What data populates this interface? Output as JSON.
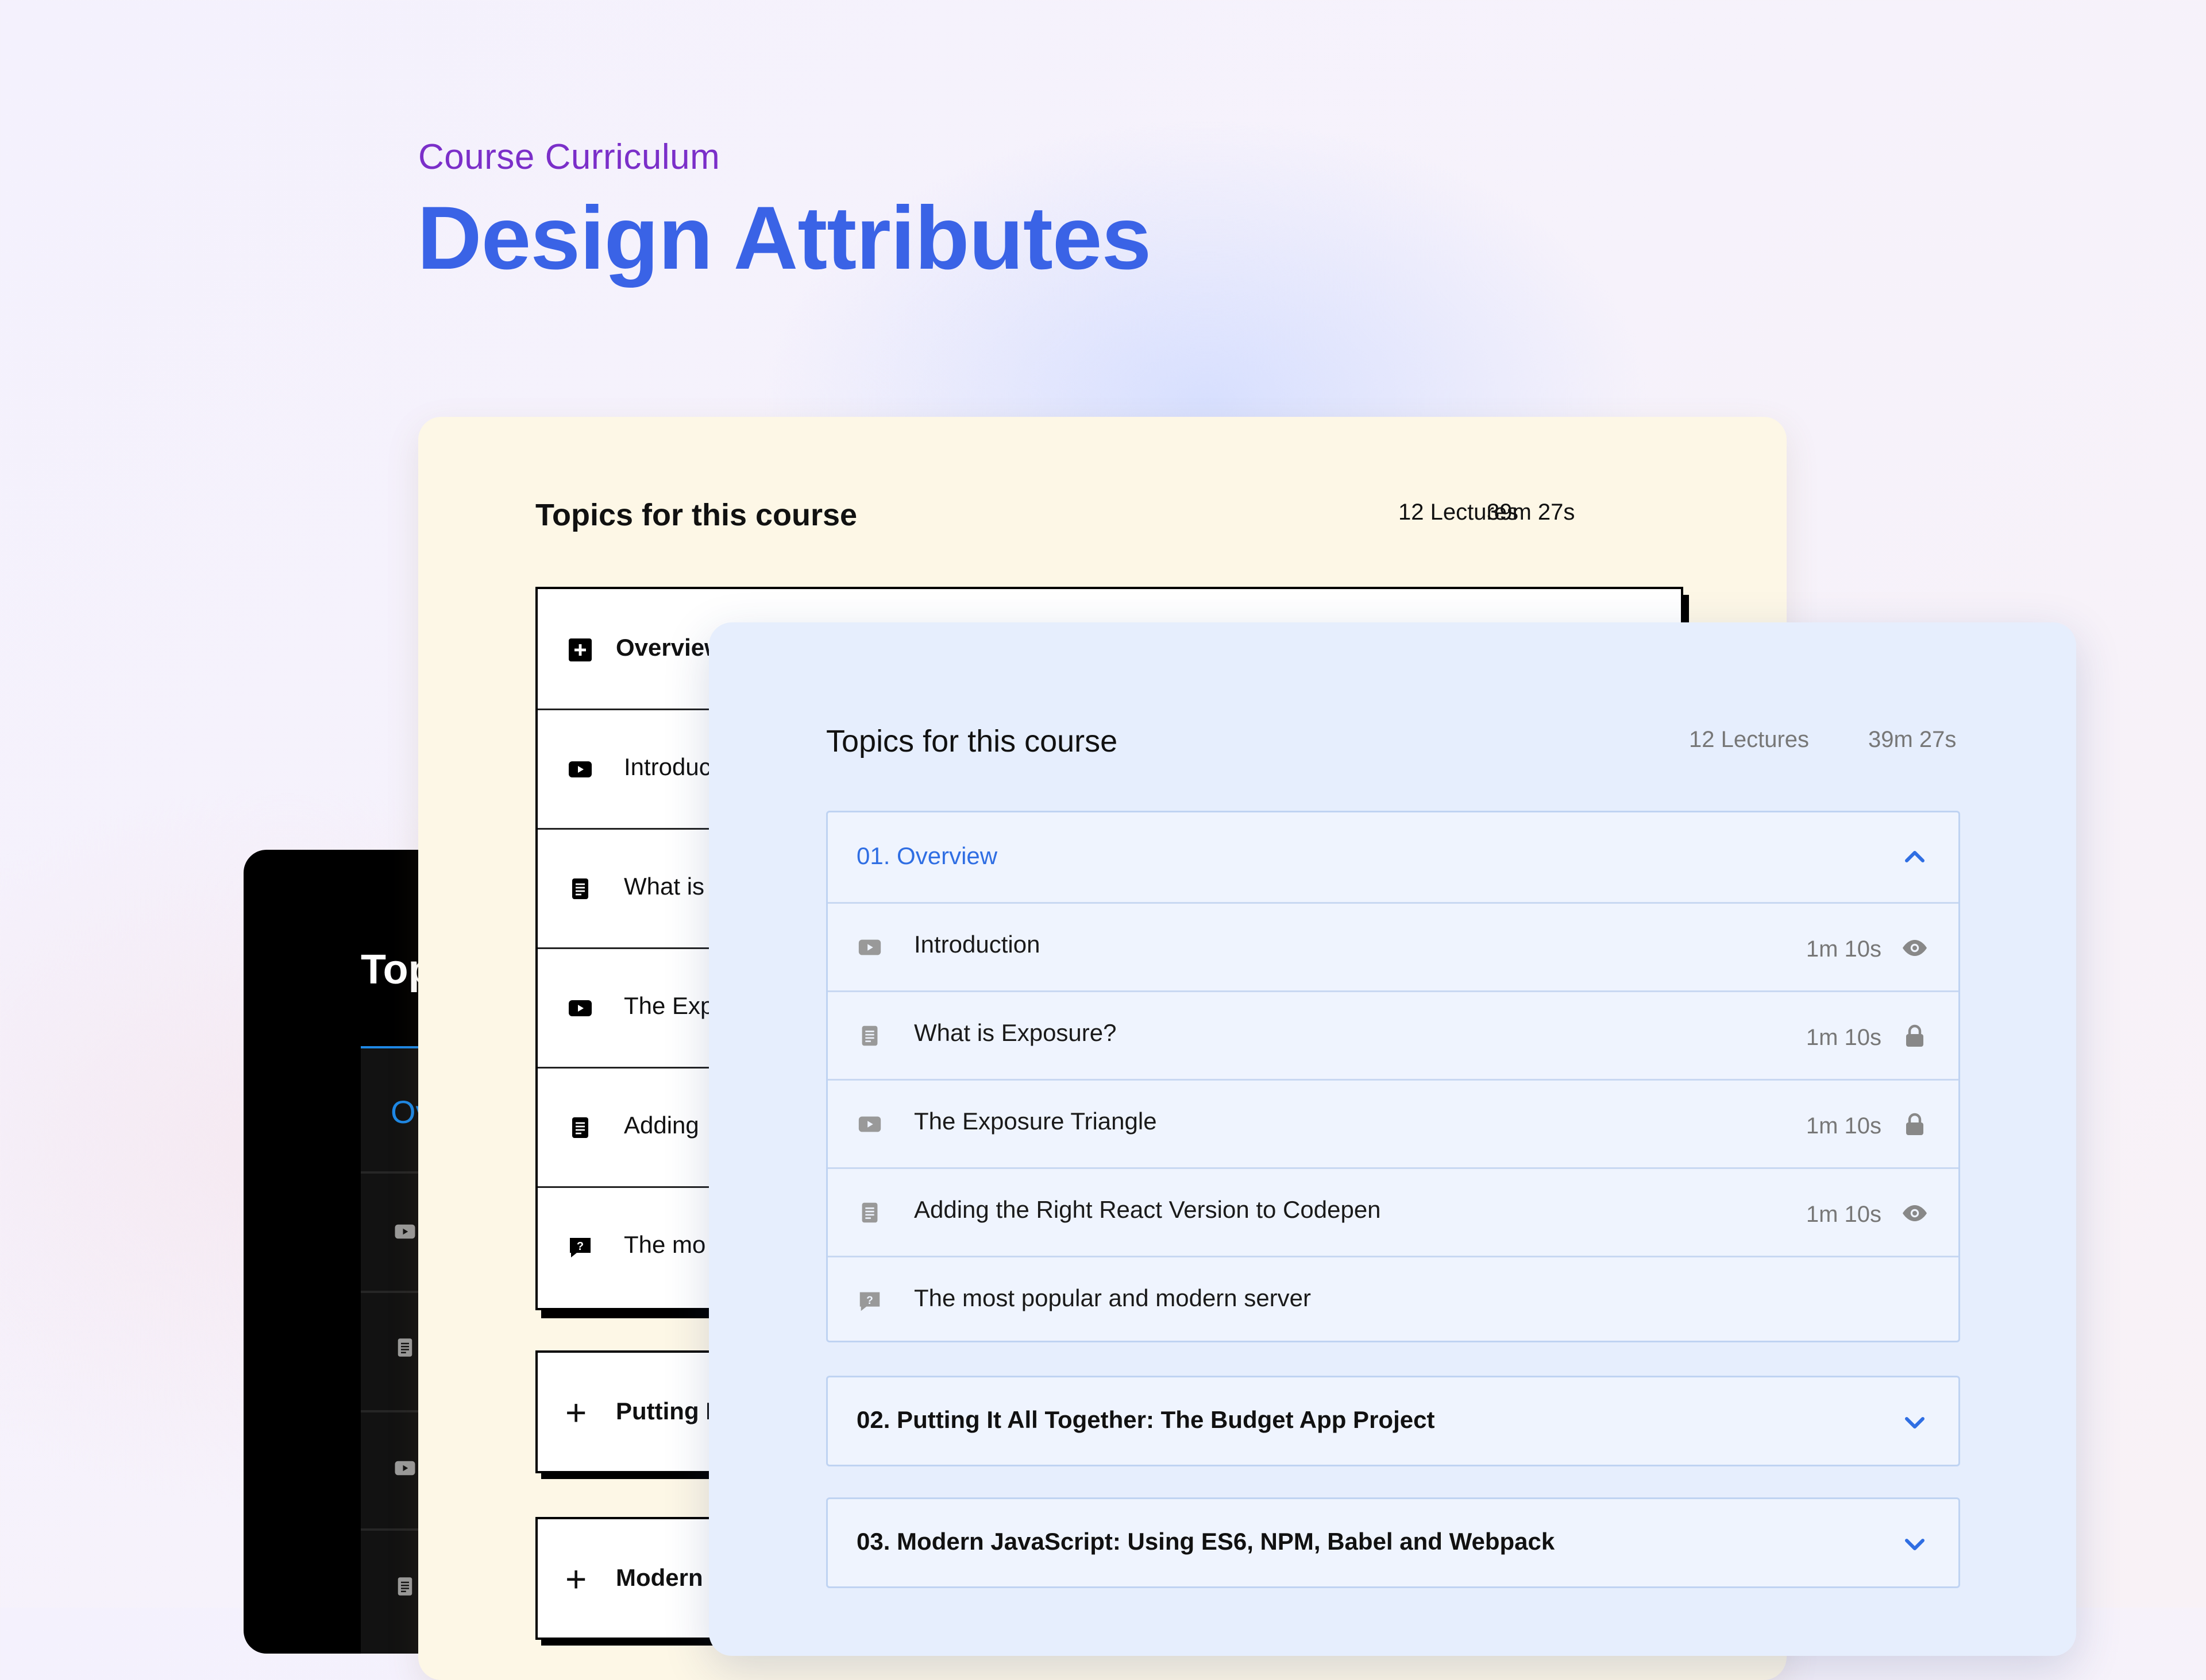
{
  "hero": {
    "eyebrow": "Course Curriculum",
    "title": "Design Attributes"
  },
  "dark_card": {
    "title_fragment": "Top",
    "section_fragment": "Ov",
    "accent_color": "#1e88e5",
    "row_icons": [
      "play-icon",
      "document-icon",
      "play-icon",
      "document-icon"
    ]
  },
  "cream_card": {
    "heading": "Topics for this course",
    "lectures": "12 Lectures",
    "duration": "39m 27s",
    "open_section": {
      "title": "Overview",
      "icon": "plus-square-icon",
      "items": [
        {
          "icon": "play-icon",
          "label": "Introduc"
        },
        {
          "icon": "document-icon",
          "label": "What is"
        },
        {
          "icon": "play-icon",
          "label": "The Exp"
        },
        {
          "icon": "document-icon",
          "label": "Adding"
        },
        {
          "icon": "quiz-icon",
          "label": "The mo"
        }
      ]
    },
    "sections": [
      {
        "label": "Putting I"
      },
      {
        "label": "Modern"
      }
    ]
  },
  "blue_card": {
    "heading": "Topics for this course",
    "lectures": "12 Lectures",
    "duration": "39m 27s",
    "accent_color": "#2f6ee3",
    "open_section": {
      "title": "01. Overview",
      "items": [
        {
          "icon": "play-icon",
          "label": "Introduction",
          "duration": "1m 10s",
          "status": "eye-icon"
        },
        {
          "icon": "document-icon",
          "label": "What is Exposure?",
          "duration": "1m 10s",
          "status": "lock-icon"
        },
        {
          "icon": "play-icon",
          "label": "The Exposure Triangle",
          "duration": "1m 10s",
          "status": "lock-icon"
        },
        {
          "icon": "document-icon",
          "label": "Adding the Right React Version to Codepen",
          "duration": "1m 10s",
          "status": "eye-icon"
        },
        {
          "icon": "quiz-icon",
          "label": "The most popular and modern server",
          "duration": "",
          "status": ""
        }
      ]
    },
    "sections": [
      {
        "label": "02. Putting It All Together: The Budget App Project"
      },
      {
        "label": "03. Modern JavaScript: Using ES6, NPM, Babel and Webpack"
      }
    ]
  }
}
